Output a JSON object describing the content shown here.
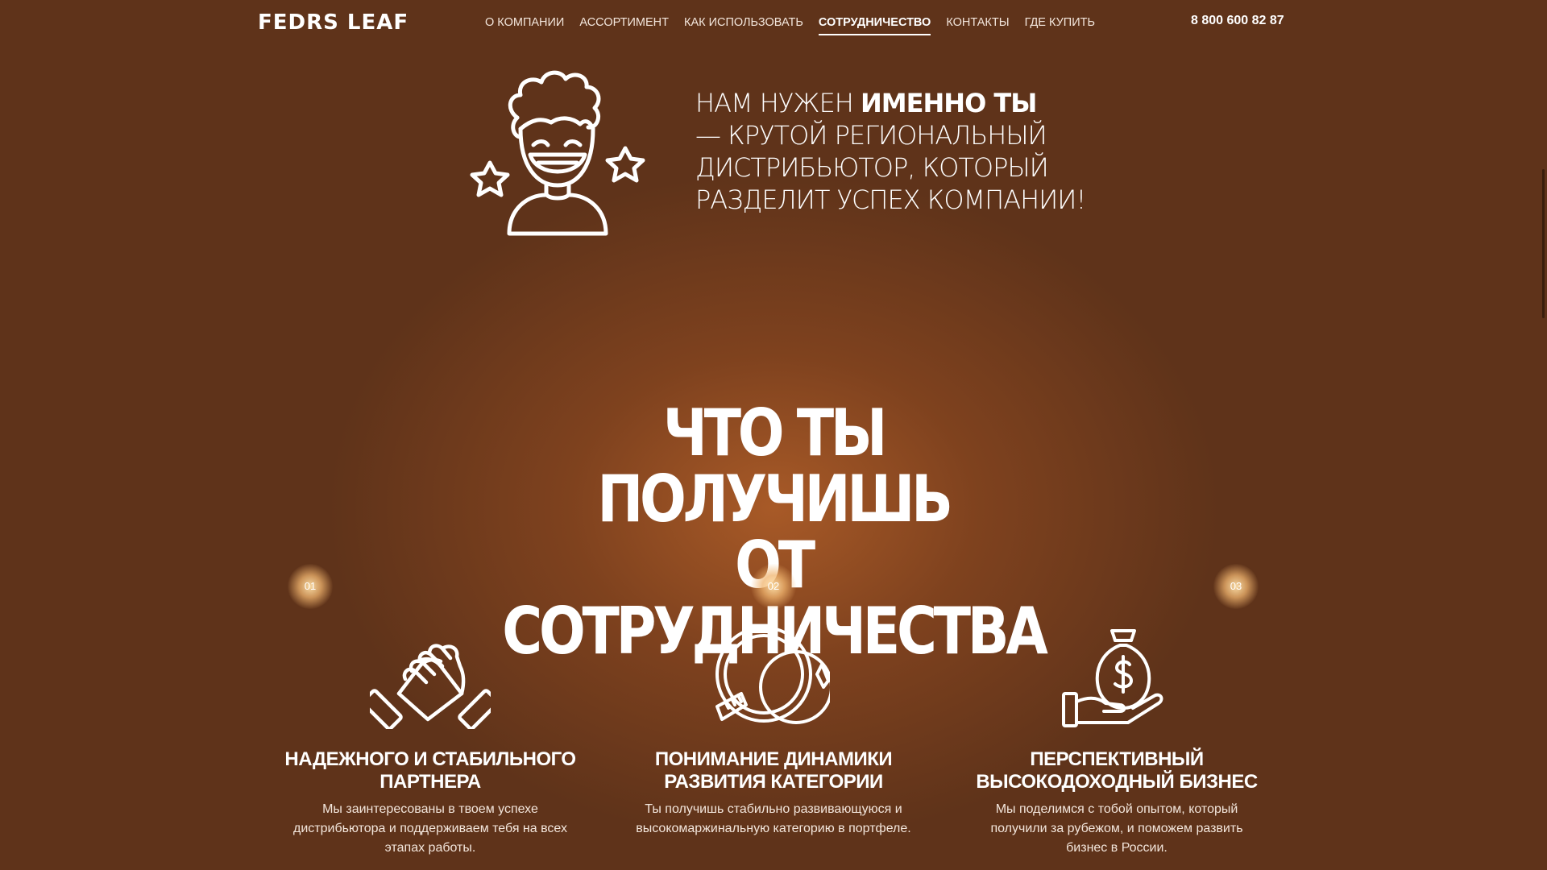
{
  "header": {
    "logo": "FEDRS LEAF",
    "nav": [
      {
        "label": "О КОМПАНИИ",
        "active": false
      },
      {
        "label": "АССОРТИМЕНТ",
        "active": false
      },
      {
        "label": "КАК ИСПОЛЬЗОВАТЬ",
        "active": false
      },
      {
        "label": "СОТРУДНИЧЕСТВО",
        "active": true
      },
      {
        "label": "КОНТАКТЫ",
        "active": false
      },
      {
        "label": "ГДЕ КУПИТЬ",
        "active": false
      }
    ],
    "phone": "8 800 600 82 87"
  },
  "hero": {
    "icon": "happy-person-with-stars-icon",
    "text_light_1": "НАМ НУЖЕН ",
    "text_bold": "ИМЕННО ТЫ",
    "text_light_2": "— КРУТОЙ РЕГИОНАЛЬНЫЙ ДИСТРИБЬЮТОР, КОТОРЫЙ РАЗДЕЛИТ УСПЕХ КОМПАНИИ!"
  },
  "section": {
    "title_line1": "ЧТО ТЫ ПОЛУЧИШЬ",
    "title_line2": "ОТ СОТРУДНИЧЕСТВА"
  },
  "benefits": [
    {
      "number": "01",
      "icon": "handshake-icon",
      "title": "НАДЕЖНОГО И СТАБИЛЬНОГО ПАРТНЕРА",
      "desc": "Мы заинтересованы в твоем успехе дистрибьютора и поддерживаем тебя на всех этапах работы."
    },
    {
      "number": "02",
      "icon": "growth-chart-icon",
      "title": "ПОНИМАНИЕ ДИНАМИКИ РАЗВИТИЯ КАТЕГОРИИ",
      "desc": "Ты получишь стабильно развивающуюся и высокомаржинальную категорию в портфеле."
    },
    {
      "number": "03",
      "icon": "money-bag-hand-icon",
      "title": "ПЕРСПЕКТИВНЫЙ ВЫСОКОДОХОДНЫЙ БИЗНЕС",
      "desc": "Мы поделимся с тобой опытом, который получили за рубежом, и поможем развить бизнес в России."
    }
  ],
  "colors": {
    "background": "#5f331a",
    "glow": "#ac5c28",
    "text": "#ffffff"
  }
}
